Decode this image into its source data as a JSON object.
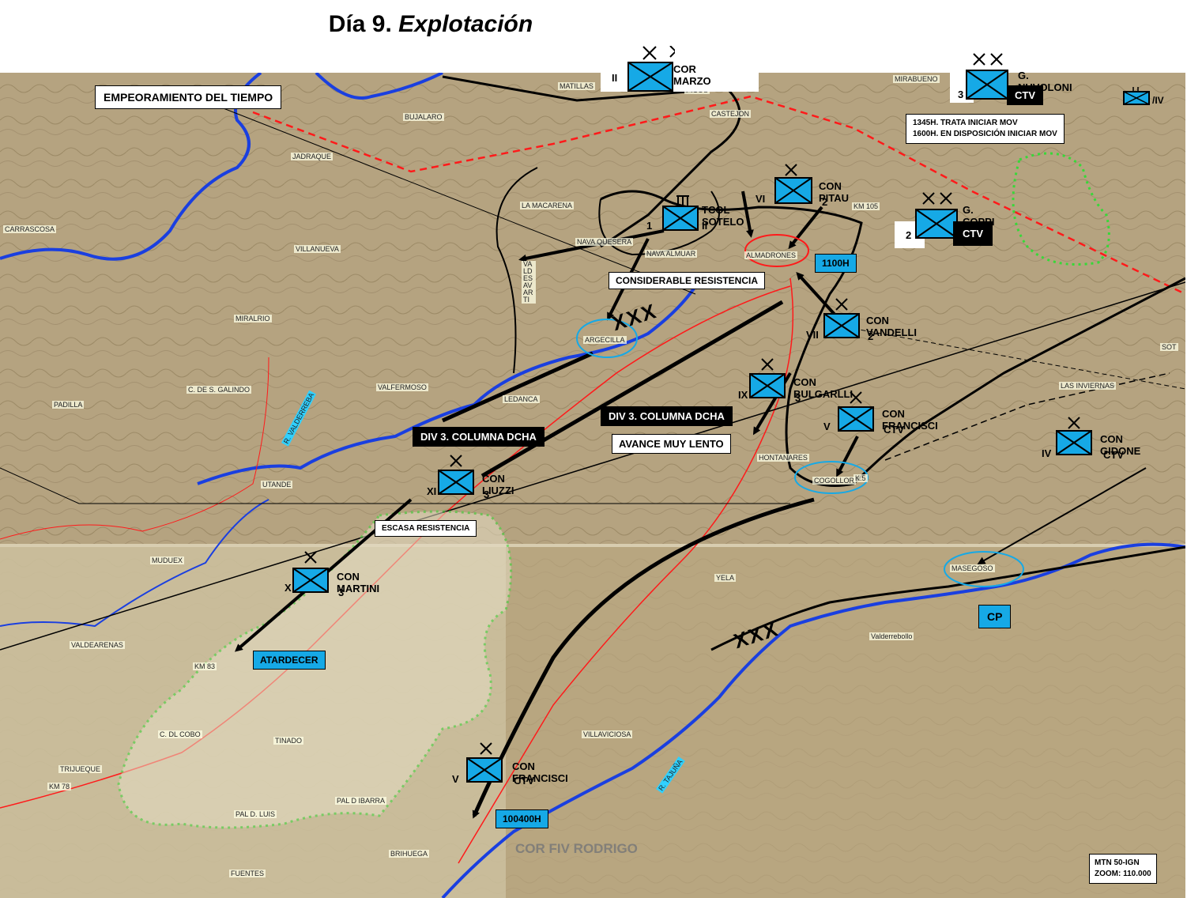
{
  "title": {
    "main": "Día 9.",
    "italic": "Explotación"
  },
  "boxes": {
    "weather": "EMPEORAMIENTO DEL TIEMPO",
    "resistance_high": "CONSIDERABLE RESISTENCIA",
    "resistance_low": "ESCASA RESISTENCIA",
    "slow_advance": "AVANCE MUY LENTO",
    "div3_left": "DIV 3. COLUMNA DCHA",
    "div3_right": "DIV 3. COLUMNA DCHA",
    "nuvoloni_note_1": "1345H. TRATA INICIAR MOV",
    "nuvoloni_note_2": "1600H. EN DISPOSICIÓN INICIAR MOV",
    "time_1100": "1100H",
    "time_atardecer": "ATARDECER",
    "time_100400": "100400H",
    "cp": "CP",
    "ctv_nuvoloni": "CTV",
    "ctv_coppi": "CTV",
    "scale_1": "MTN 50-IGN",
    "scale_2": "ZOOM: 110.000"
  },
  "units": {
    "cor_marzo": {
      "name": "COR MARZO",
      "echelon": "II"
    },
    "nuvoloni": {
      "name": "G. NUVOLONI",
      "number": "3"
    },
    "small_iv": {
      "suffix": "/IV"
    },
    "pitau": {
      "name": "CON PITAU",
      "echelon": "VI",
      "number": "2"
    },
    "sotelo": {
      "name": "TCOL SOTELO",
      "number": "1",
      "echelon": "II"
    },
    "coppi": {
      "name": "G. COPPI",
      "number": "2"
    },
    "vandelli": {
      "name": "CON VANDELLI",
      "echelon": "VII",
      "number": "2"
    },
    "bulgarlli": {
      "name": "CON BULGARLLI",
      "echelon": "IX",
      "number": "3"
    },
    "francisci_top": {
      "name": "CON FRANCISCI",
      "echelon": "V",
      "sub": "CTV"
    },
    "gidone": {
      "name": "CON GIDONE",
      "echelon": "IV",
      "sub": "CTV"
    },
    "liuzzi": {
      "name": "CON LIUZZI",
      "echelon": "XI",
      "number": "3"
    },
    "martini": {
      "name": "CON MARTINI",
      "echelon": "X",
      "number": "3"
    },
    "francisci_bottom": {
      "name": "CON FRANCISCI",
      "echelon": "V",
      "sub": "CTV"
    }
  },
  "corps": {
    "xxx": "XXX"
  },
  "places": {
    "carrascosa": "CARRASCOSA",
    "jadraque": "JADRAQUE",
    "bujalaro": "BUJALARO",
    "matillas": "MATILLAS",
    "villanueva": "VILLANUEVA",
    "miralrio": "MIRALRIO",
    "padilla": "PADILLA",
    "galindo": "C. DE S. GALINDO",
    "valfermoso": "VALFERMOSO",
    "utande": "UTANDE",
    "muduex": "MUDUEX",
    "valdearenas": "VALDEARENAS",
    "km83": "KM 83",
    "cobo": "C. DL COBO",
    "tinado": "TINADO",
    "trijueque": "TRIJUEQUE",
    "km78": "KM 78",
    "pal_luis": "PAL D. LUIS",
    "pal_ibarra": "PAL D IBARRA",
    "brihuega": "BRIHUEGA",
    "fuentes": "FUENTES",
    "la_macarena": "LA MACARENA",
    "nava_quesera": "NAVA QUESERA",
    "nava_almuar": "NAVA ALMUAR",
    "almadrones": "ALMADRONES",
    "castejon": "CASTEJON",
    "picos": "PICOS",
    "mirabueno": "MIRABUENO",
    "km105": "KM 105",
    "argecilla": "ARGECILLA",
    "ledanca": "LEDANCA",
    "hontanares": "HONTANARES",
    "cogollor": "COGOLLOR",
    "k5": "K.5",
    "las_inviernas": "LAS INVIERNAS",
    "masegoso": "MASEGOSO",
    "yela": "YELA",
    "valderrebollo": "Valderrebollo",
    "villaviciosa": "VILLAVICIOSA",
    "valdesaz": "VALDESAVARTI",
    "r_valdearenas": "R. VALDERREBA",
    "r_tajuna": "R. TAJUÑA",
    "sot": "SOT",
    "cor_fiv": "COR FIV RODRIGO"
  },
  "colors": {
    "river": "#1a3fe0",
    "road": "#ff1a1a",
    "front": "#000000",
    "forest": "#38d838",
    "unit_fill": "#16a9e6"
  }
}
